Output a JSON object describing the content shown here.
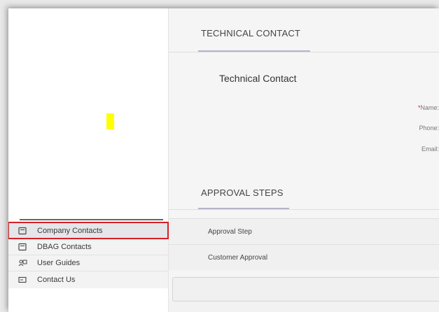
{
  "sidebar": {
    "items": [
      {
        "label": "Company Contacts",
        "icon": "contact-card-icon",
        "active": true
      },
      {
        "label": "DBAG Contacts",
        "icon": "contact-card-icon",
        "active": false
      },
      {
        "label": "User Guides",
        "icon": "user-guide-icon",
        "active": false
      },
      {
        "label": "Contact Us",
        "icon": "contact-us-icon",
        "active": false
      }
    ]
  },
  "main": {
    "technical": {
      "section_title": "TECHNICAL CONTACT",
      "subheading": "Technical Contact",
      "name_required": "*",
      "name_label": "Name:",
      "phone_label": "Phone:",
      "email_label": "Email:"
    },
    "approval": {
      "section_title": "APPROVAL STEPS",
      "rows": [
        "Approval Step",
        "Customer Approval"
      ]
    }
  },
  "colors": {
    "highlight_marker": "#ffff00",
    "active_outline": "#d61f26",
    "required": "#d61f26"
  }
}
